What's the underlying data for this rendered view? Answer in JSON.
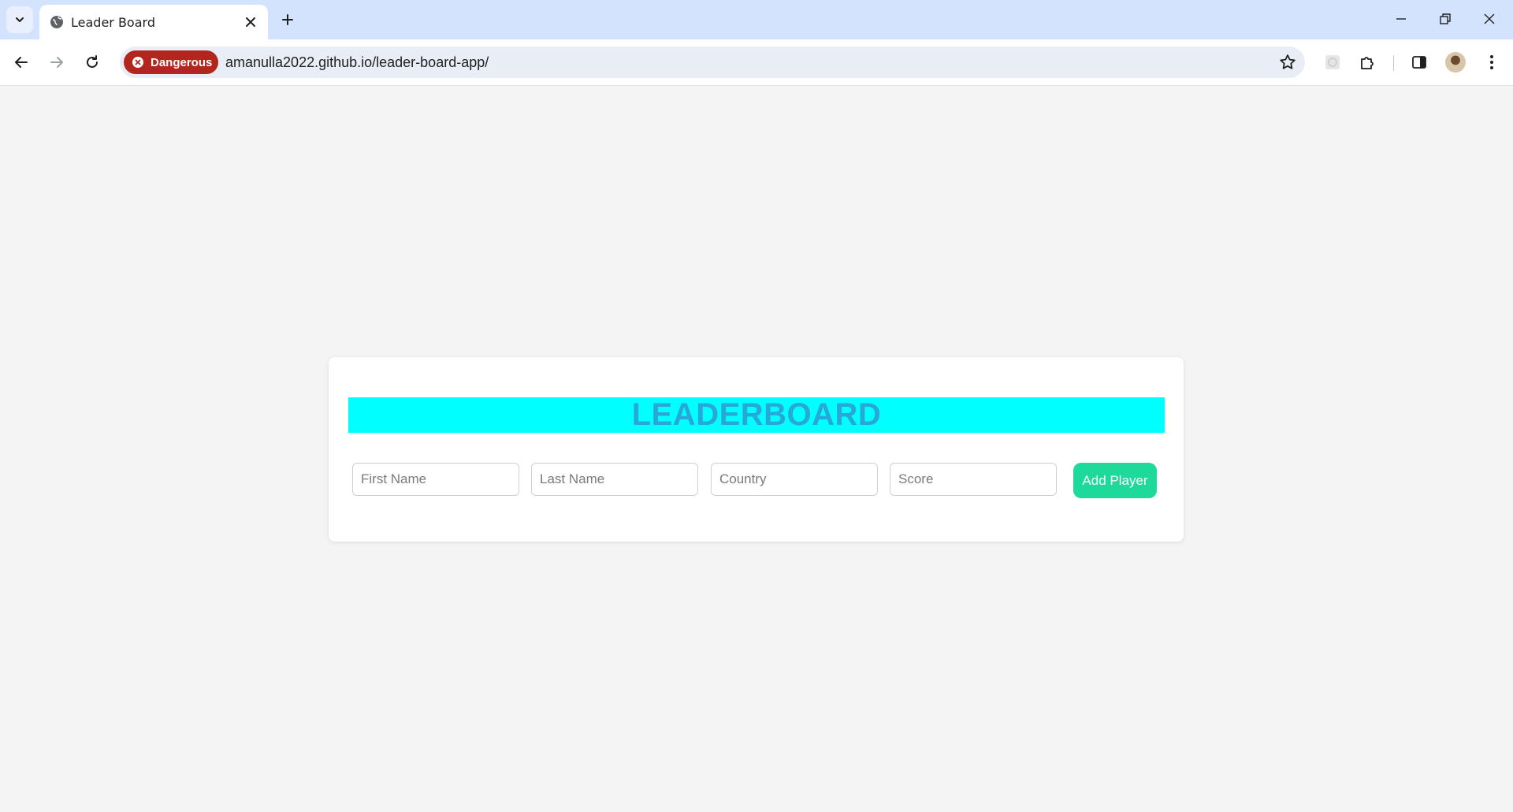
{
  "browser": {
    "tab": {
      "title": "Leader Board"
    },
    "address_bar": {
      "security_label": "Dangerous",
      "url": "amanulla2022.github.io/leader-board-app/"
    },
    "colors": {
      "danger": "#b3261e",
      "tabstrip": "#d3e3fd"
    }
  },
  "page": {
    "title": "LEADERBOARD",
    "form": {
      "first_name_placeholder": "First Name",
      "last_name_placeholder": "Last Name",
      "country_placeholder": "Country",
      "score_placeholder": "Score",
      "add_button_label": "Add Player"
    },
    "colors": {
      "banner": "#00ffff",
      "title": "#26a8d8",
      "button": "#1dd99a"
    }
  }
}
